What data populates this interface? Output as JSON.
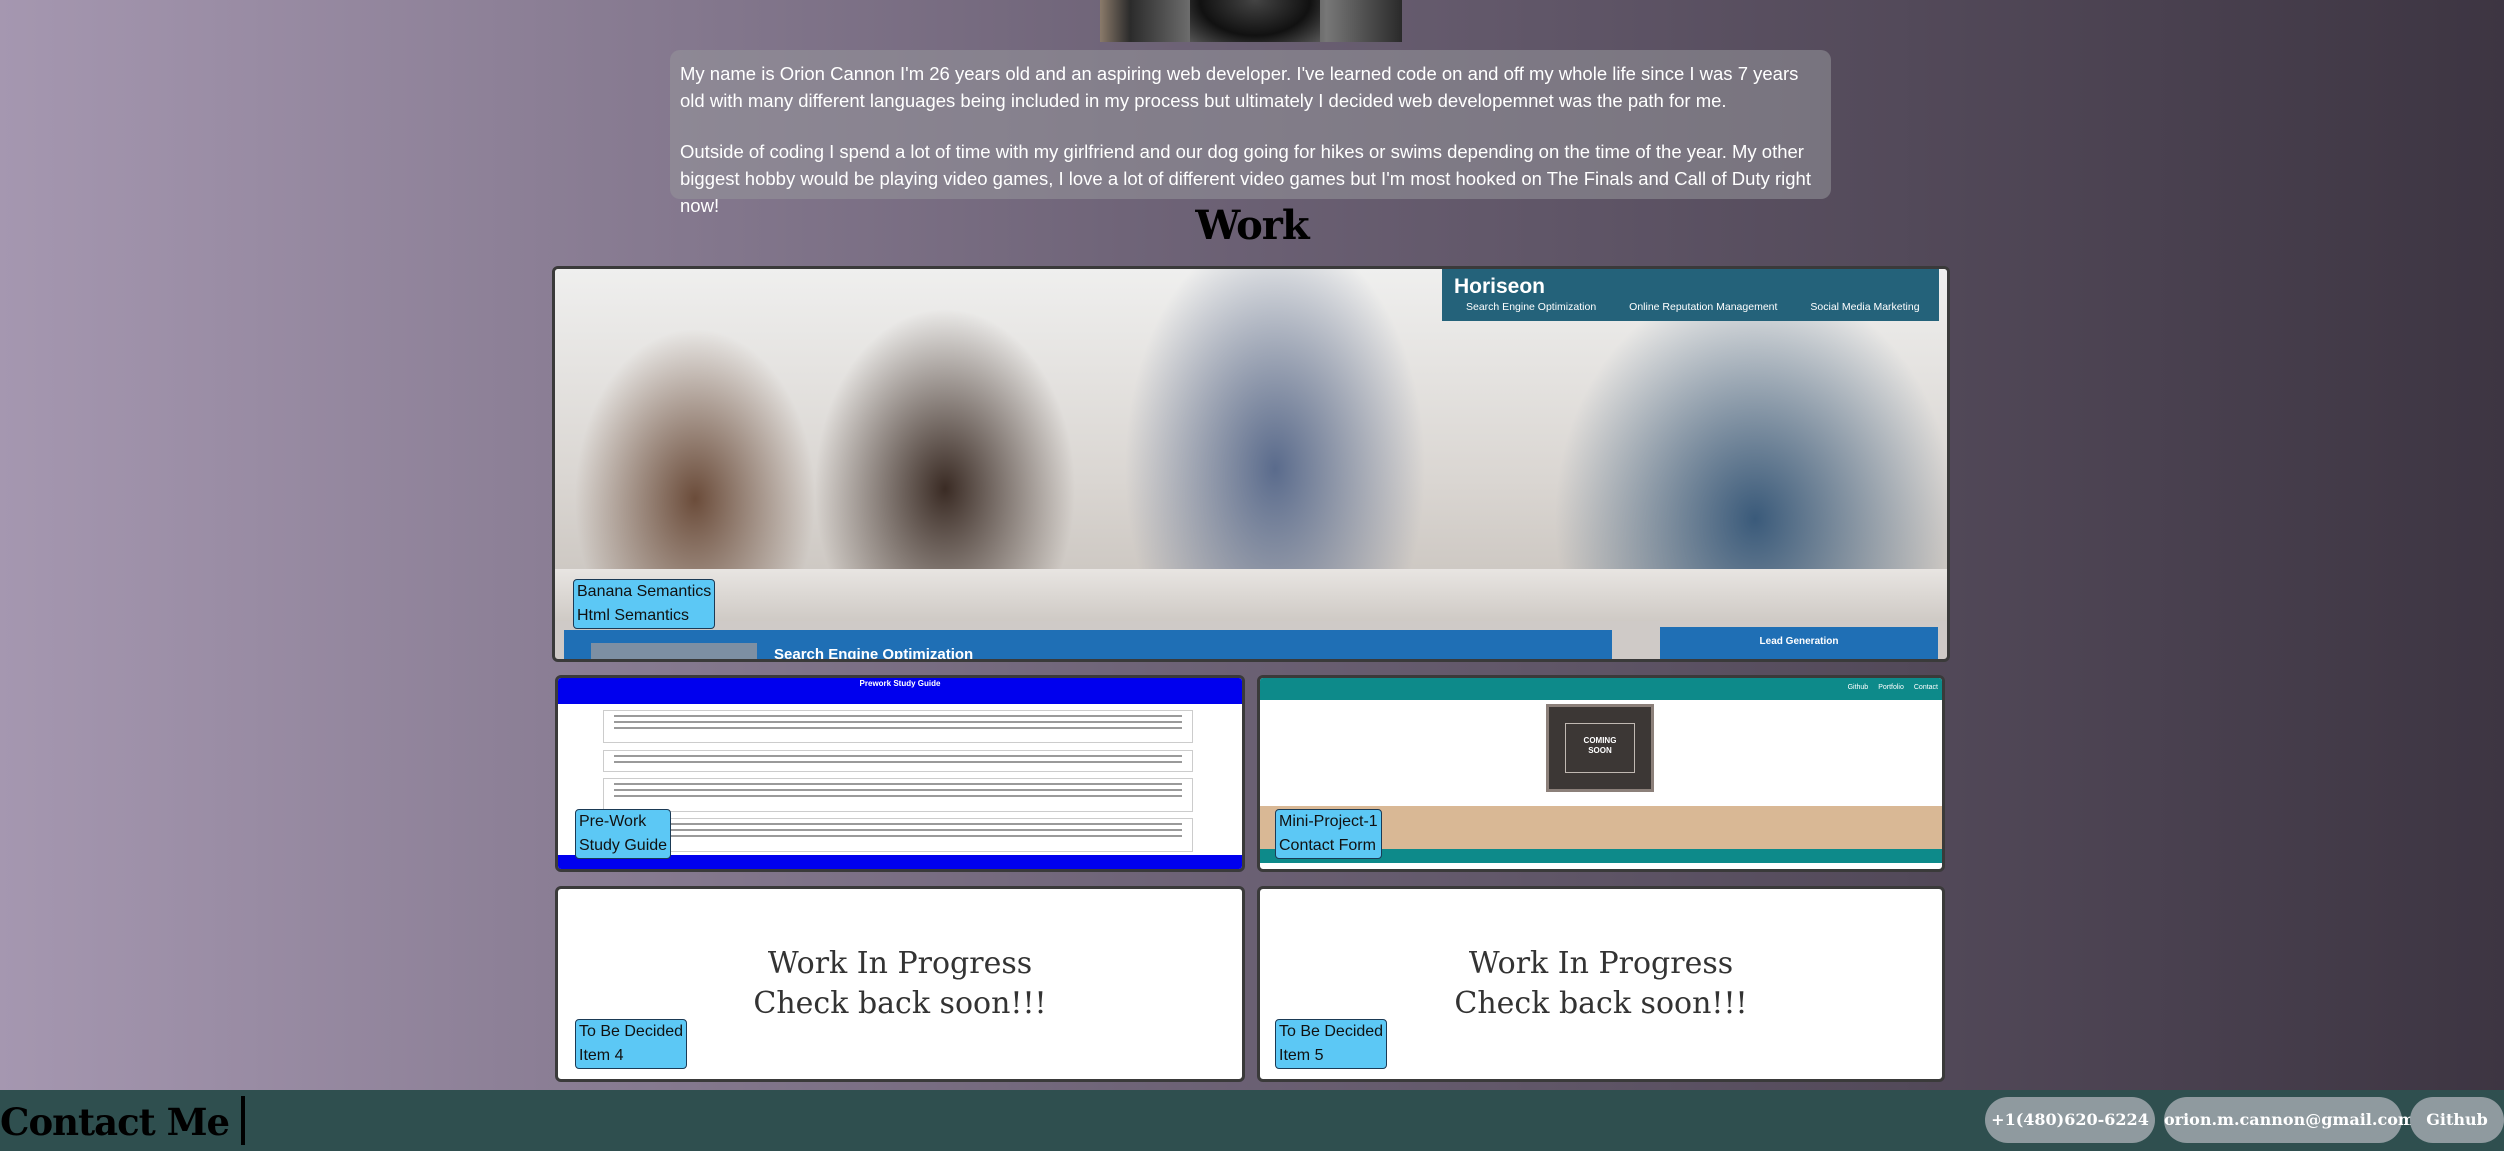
{
  "about": {
    "paragraphs": [
      "My name is Orion Cannon I'm 26 years old and an aspiring web developer. I've learned code on and off my whole life since I was 7 years old with many different languages being included in my process but ultimately I decided web developemnet was the path for me.",
      "Outside of coding I spend a lot of time with my girlfriend and our dog going for hikes or swims depending on the time of the year. My other biggest hobby would be playing video games, I love a lot of different video games but I'm most hooked on The Finals and Call of Duty right now!"
    ]
  },
  "work": {
    "heading": "Work",
    "projects": [
      {
        "label_line1": "Banana Semantics",
        "label_line2": "Html Semantics",
        "preview": {
          "brand": "Horiseon",
          "nav": [
            "Search Engine Optimization",
            "Online Reputation Management",
            "Social Media Marketing"
          ],
          "banner": "Search Engine Optimization",
          "side": "Lead Generation"
        }
      },
      {
        "label_line1": "Pre-Work",
        "label_line2": "Study Guide",
        "preview": {
          "title": "Prework Study Guide"
        }
      },
      {
        "label_line1": "Mini-Project-1",
        "label_line2": "Contact Form",
        "preview": {
          "nav": [
            "Github",
            "Portfolio",
            "Contact"
          ],
          "badge_line1": "COMING",
          "badge_line2": "SOON"
        }
      },
      {
        "label_line1": "To Be Decided",
        "label_line2": "Item 4",
        "wip_line1": "Work In Progress",
        "wip_line2": "Check back soon!!!"
      },
      {
        "label_line1": "To Be Decided",
        "label_line2": "Item 5",
        "wip_line1": "Work In Progress",
        "wip_line2": "Check back soon!!!"
      }
    ]
  },
  "footer": {
    "title": "Contact Me",
    "phone": "+1(480)620-6224",
    "email": "orion.m.cannon@gmail.com",
    "github": "Github"
  }
}
